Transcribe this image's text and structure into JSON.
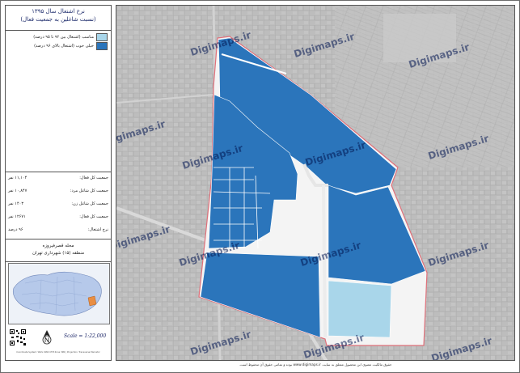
{
  "title": {
    "line1": "نرخ اشتغال سال ۱۳۹۵",
    "line2": "(نسبت شاغلین به جمعیت فعال)"
  },
  "legend": [
    {
      "label": "مناسب (اشتغال بین ۹۲ تا ۹۵ درصد)",
      "color": "#a9d6ea"
    },
    {
      "label": "خیلی خوب (اشتغال بالای ۹۶ درصد)",
      "color": "#2b75bb"
    }
  ],
  "stats": [
    {
      "label": "جمعیت کل فعال:",
      "value": "۱۱,۱۰۴ نفر"
    },
    {
      "label": "جمعیت کل شاغل مرد:",
      "value": "۱۰,۸۴۷ نفر"
    },
    {
      "label": "جمعیت کل شاغل زن:",
      "value": "۱۴۰۳ نفر"
    },
    {
      "label": "جمعیت کل فعال:",
      "value": "۱۲۶۷۱ نفر"
    },
    {
      "label": "نرخ اشتغال:",
      "value": "۹۶ درصد"
    }
  ],
  "area": {
    "name": "محله قصرفیروزه",
    "district": "منطقه (۱۵) شهرداری تهران"
  },
  "scale": "Scale = 1:22,000",
  "footnote": "Coordinate System: WGS 1984 UTM Zone 39N | Projection: Transverse Mercator",
  "copyright": "حقوق مالکیت معنوی این محصول متعلق به سایت www.digimaps.ir بوده و تمامی حقوق آن محفوظ است.",
  "watermark": "Digimaps.ir",
  "colors": {
    "very_good": "#2b75bb",
    "good": "#a9d6ea",
    "boundary": "#e0707a",
    "basemap": "#bcbcbc"
  }
}
